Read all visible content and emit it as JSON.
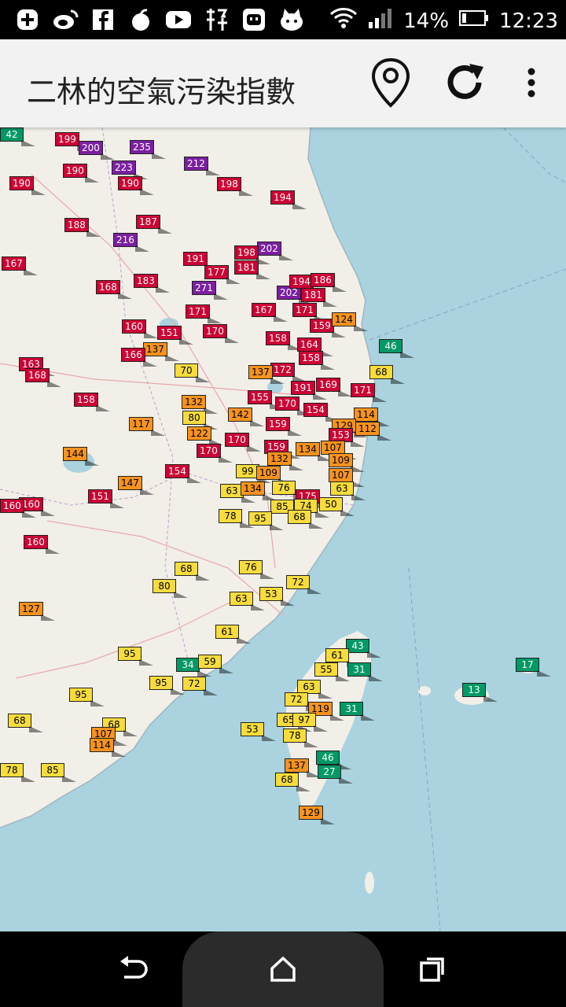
{
  "status_bar": {
    "battery_text": "14%",
    "time": "12:23",
    "left_icons": [
      "plus-icon",
      "weibo-icon",
      "facebook-icon",
      "apple-icon",
      "youtube-icon",
      "jing-app-icon",
      "robot-app-icon",
      "cat-app-icon"
    ],
    "right_icons": [
      "wifi-icon",
      "signal-icon",
      "battery-icon"
    ]
  },
  "app_bar": {
    "title": "二林的空氣污染指數",
    "location_button": "location-pin-icon",
    "refresh_button": "refresh-icon",
    "menu_button": "more-vert-icon"
  },
  "colors": {
    "purple": "#7b1fa2",
    "red": "#cc0033",
    "orange": "#f7931e",
    "yellow": "#f7dc3c",
    "green": "#009966",
    "sea": "#aad3df",
    "land": "#f2efe9"
  },
  "map": {
    "markers": [
      {
        "value": "199",
        "color": "red"
      },
      {
        "value": "200",
        "color": "purple"
      },
      {
        "value": "235",
        "color": "purple"
      },
      {
        "value": "190",
        "color": "red"
      },
      {
        "value": "223",
        "color": "purple"
      },
      {
        "value": "212",
        "color": "purple"
      },
      {
        "value": "190",
        "color": "red"
      },
      {
        "value": "190",
        "color": "red"
      },
      {
        "value": "198",
        "color": "red"
      },
      {
        "value": "194",
        "color": "red"
      },
      {
        "value": "188",
        "color": "red"
      },
      {
        "value": "216",
        "color": "purple"
      },
      {
        "value": "187",
        "color": "red"
      },
      {
        "value": "202",
        "color": "purple"
      },
      {
        "value": "198",
        "color": "red"
      },
      {
        "value": "167",
        "color": "red"
      },
      {
        "value": "191",
        "color": "red"
      },
      {
        "value": "181",
        "color": "red"
      },
      {
        "value": "177",
        "color": "red"
      },
      {
        "value": "168",
        "color": "red"
      },
      {
        "value": "183",
        "color": "red"
      },
      {
        "value": "271",
        "color": "purple"
      },
      {
        "value": "202",
        "color": "purple"
      },
      {
        "value": "194",
        "color": "red"
      },
      {
        "value": "186",
        "color": "red"
      },
      {
        "value": "181",
        "color": "red"
      },
      {
        "value": "171",
        "color": "red"
      },
      {
        "value": "167",
        "color": "red"
      },
      {
        "value": "171",
        "color": "red"
      },
      {
        "value": "160",
        "color": "red"
      },
      {
        "value": "151",
        "color": "red"
      },
      {
        "value": "170",
        "color": "red"
      },
      {
        "value": "159",
        "color": "red"
      },
      {
        "value": "124",
        "color": "orange"
      },
      {
        "value": "46",
        "color": "green"
      },
      {
        "value": "137",
        "color": "orange"
      },
      {
        "value": "166",
        "color": "red"
      },
      {
        "value": "158",
        "color": "red"
      },
      {
        "value": "164",
        "color": "red"
      },
      {
        "value": "163",
        "color": "red"
      },
      {
        "value": "168",
        "color": "red"
      },
      {
        "value": "158",
        "color": "red"
      },
      {
        "value": "172",
        "color": "red"
      },
      {
        "value": "70",
        "color": "yellow"
      },
      {
        "value": "68",
        "color": "yellow"
      },
      {
        "value": "191",
        "color": "red"
      },
      {
        "value": "169",
        "color": "red"
      },
      {
        "value": "171",
        "color": "red"
      },
      {
        "value": "137",
        "color": "orange"
      },
      {
        "value": "158",
        "color": "red"
      },
      {
        "value": "132",
        "color": "orange"
      },
      {
        "value": "155",
        "color": "red"
      },
      {
        "value": "170",
        "color": "red"
      },
      {
        "value": "154",
        "color": "red"
      },
      {
        "value": "114",
        "color": "orange"
      },
      {
        "value": "80",
        "color": "yellow"
      },
      {
        "value": "142",
        "color": "orange"
      },
      {
        "value": "117",
        "color": "orange"
      },
      {
        "value": "159",
        "color": "red"
      },
      {
        "value": "129",
        "color": "orange"
      },
      {
        "value": "112",
        "color": "orange"
      },
      {
        "value": "122",
        "color": "orange"
      },
      {
        "value": "170",
        "color": "red"
      },
      {
        "value": "153",
        "color": "red"
      },
      {
        "value": "144",
        "color": "orange"
      },
      {
        "value": "159",
        "color": "red"
      },
      {
        "value": "134",
        "color": "orange"
      },
      {
        "value": "107",
        "color": "orange"
      },
      {
        "value": "170",
        "color": "red"
      },
      {
        "value": "132",
        "color": "orange"
      },
      {
        "value": "109",
        "color": "orange"
      },
      {
        "value": "99",
        "color": "yellow"
      },
      {
        "value": "109",
        "color": "orange"
      },
      {
        "value": "107",
        "color": "orange"
      },
      {
        "value": "154",
        "color": "red"
      },
      {
        "value": "147",
        "color": "orange"
      },
      {
        "value": "63",
        "color": "yellow"
      },
      {
        "value": "134",
        "color": "orange"
      },
      {
        "value": "76",
        "color": "yellow"
      },
      {
        "value": "175",
        "color": "red"
      },
      {
        "value": "63",
        "color": "yellow"
      },
      {
        "value": "151",
        "color": "red"
      },
      {
        "value": "160",
        "color": "red"
      },
      {
        "value": "160",
        "color": "red"
      },
      {
        "value": "85",
        "color": "yellow"
      },
      {
        "value": "74",
        "color": "yellow"
      },
      {
        "value": "50",
        "color": "yellow"
      },
      {
        "value": "78",
        "color": "yellow"
      },
      {
        "value": "95",
        "color": "yellow"
      },
      {
        "value": "68",
        "color": "yellow"
      },
      {
        "value": "160",
        "color": "red"
      },
      {
        "value": "68",
        "color": "yellow"
      },
      {
        "value": "76",
        "color": "yellow"
      },
      {
        "value": "80",
        "color": "yellow"
      },
      {
        "value": "53",
        "color": "yellow"
      },
      {
        "value": "72",
        "color": "yellow"
      },
      {
        "value": "127",
        "color": "orange"
      },
      {
        "value": "63",
        "color": "yellow"
      },
      {
        "value": "61",
        "color": "yellow"
      },
      {
        "value": "43",
        "color": "green"
      },
      {
        "value": "95",
        "color": "yellow"
      },
      {
        "value": "61",
        "color": "yellow"
      },
      {
        "value": "34",
        "color": "green"
      },
      {
        "value": "59",
        "color": "yellow"
      },
      {
        "value": "55",
        "color": "yellow"
      },
      {
        "value": "31",
        "color": "green"
      },
      {
        "value": "17",
        "color": "green"
      },
      {
        "value": "95",
        "color": "yellow"
      },
      {
        "value": "72",
        "color": "yellow"
      },
      {
        "value": "63",
        "color": "yellow"
      },
      {
        "value": "95",
        "color": "yellow"
      },
      {
        "value": "13",
        "color": "green"
      },
      {
        "value": "72",
        "color": "yellow"
      },
      {
        "value": "119",
        "color": "orange"
      },
      {
        "value": "31",
        "color": "green"
      },
      {
        "value": "68",
        "color": "yellow"
      },
      {
        "value": "68",
        "color": "yellow"
      },
      {
        "value": "65",
        "color": "yellow"
      },
      {
        "value": "97",
        "color": "yellow"
      },
      {
        "value": "107",
        "color": "orange"
      },
      {
        "value": "53",
        "color": "yellow"
      },
      {
        "value": "78",
        "color": "yellow"
      },
      {
        "value": "114",
        "color": "orange"
      },
      {
        "value": "46",
        "color": "green"
      },
      {
        "value": "137",
        "color": "orange"
      },
      {
        "value": "78",
        "color": "yellow"
      },
      {
        "value": "27",
        "color": "green"
      },
      {
        "value": "85",
        "color": "yellow"
      },
      {
        "value": "68",
        "color": "yellow"
      },
      {
        "value": "129",
        "color": "orange"
      },
      {
        "value": "42",
        "color": "green"
      }
    ]
  },
  "nav_bar": {
    "back": "back-icon",
    "home": "home-icon",
    "recents": "recents-icon"
  }
}
